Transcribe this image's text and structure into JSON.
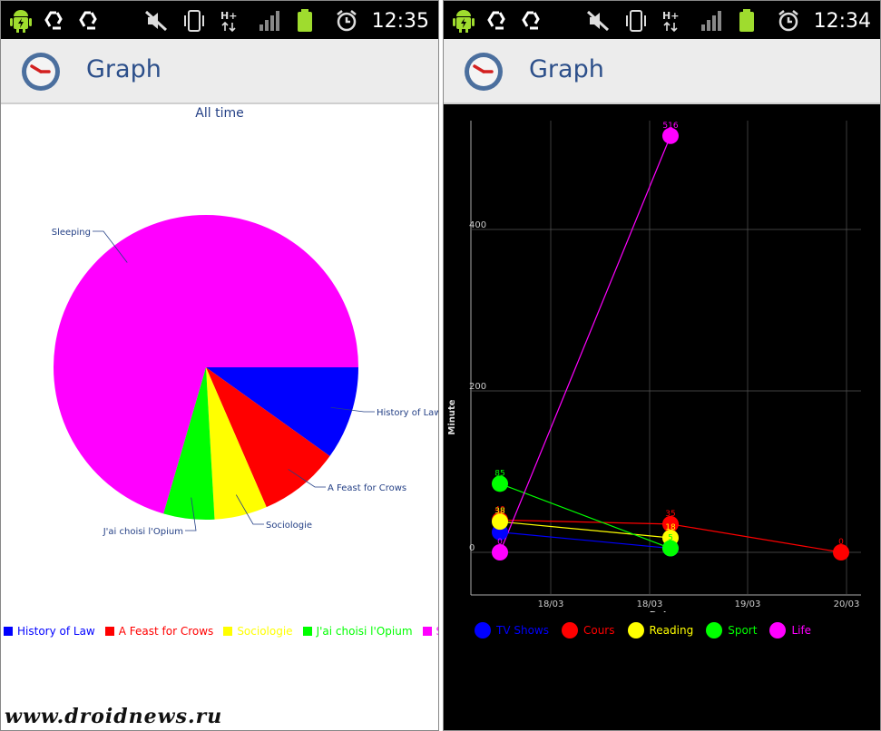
{
  "left_screen": {
    "status_time": "12:35",
    "app_title": "Graph",
    "chart_title": "All time"
  },
  "right_screen": {
    "status_time": "12:34",
    "app_title": "Graph"
  },
  "watermark": "www.droidnews.ru",
  "icons": [
    "android-icon",
    "recycle-icon",
    "mute-icon",
    "vibrate-icon",
    "hplus-signal-icon",
    "signal-bars-icon",
    "battery-icon",
    "alarm-icon",
    "clock-app-icon"
  ],
  "chart_data": [
    {
      "type": "pie",
      "title": "All time",
      "slices": [
        {
          "label": "History of Law",
          "value": 9.9,
          "color": "#0000ff"
        },
        {
          "label": "A Feast for Crows",
          "value": 8.6,
          "color": "#ff0000"
        },
        {
          "label": "Sociologie",
          "value": 5.6,
          "color": "#ffff00"
        },
        {
          "label": "J'ai choisi l'Opium",
          "value": 5.4,
          "color": "#00ff00"
        },
        {
          "label": "Sleeping",
          "value": 70.5,
          "color": "#ff00ff"
        }
      ],
      "legend": "bottom"
    },
    {
      "type": "line",
      "xlabel": "Date",
      "ylabel": "Minute",
      "x_ticks": [
        "18/03",
        "18/03",
        "19/03",
        "20/03"
      ],
      "y_ticks": [
        "0",
        "200",
        "400"
      ],
      "ylim": [
        -50,
        540
      ],
      "grid": true,
      "legend": "bottom",
      "series": [
        {
          "name": "TV Shows",
          "color": "#0000ff",
          "points": [
            {
              "x": "17/03",
              "y": 25,
              "label": "25"
            },
            {
              "x": "18/03",
              "y": 5,
              "label": "5"
            }
          ]
        },
        {
          "name": "Cours",
          "color": "#ff0000",
          "points": [
            {
              "x": "17/03",
              "y": 40,
              "label": "40"
            },
            {
              "x": "18/03",
              "y": 35,
              "label": "35"
            },
            {
              "x": "20/03",
              "y": 0,
              "label": "0"
            }
          ]
        },
        {
          "name": "Reading",
          "color": "#ffff00",
          "points": [
            {
              "x": "17/03",
              "y": 38,
              "label": "38"
            },
            {
              "x": "18/03",
              "y": 18,
              "label": "18"
            }
          ]
        },
        {
          "name": "Sport",
          "color": "#00ff00",
          "points": [
            {
              "x": "17/03",
              "y": 85,
              "label": "85"
            },
            {
              "x": "18/03",
              "y": 5,
              "label": "5"
            }
          ]
        },
        {
          "name": "Life",
          "color": "#ff00ff",
          "points": [
            {
              "x": "17/03",
              "y": 0,
              "label": "0"
            },
            {
              "x": "18/03",
              "y": 516,
              "label": "516"
            }
          ]
        }
      ]
    }
  ]
}
